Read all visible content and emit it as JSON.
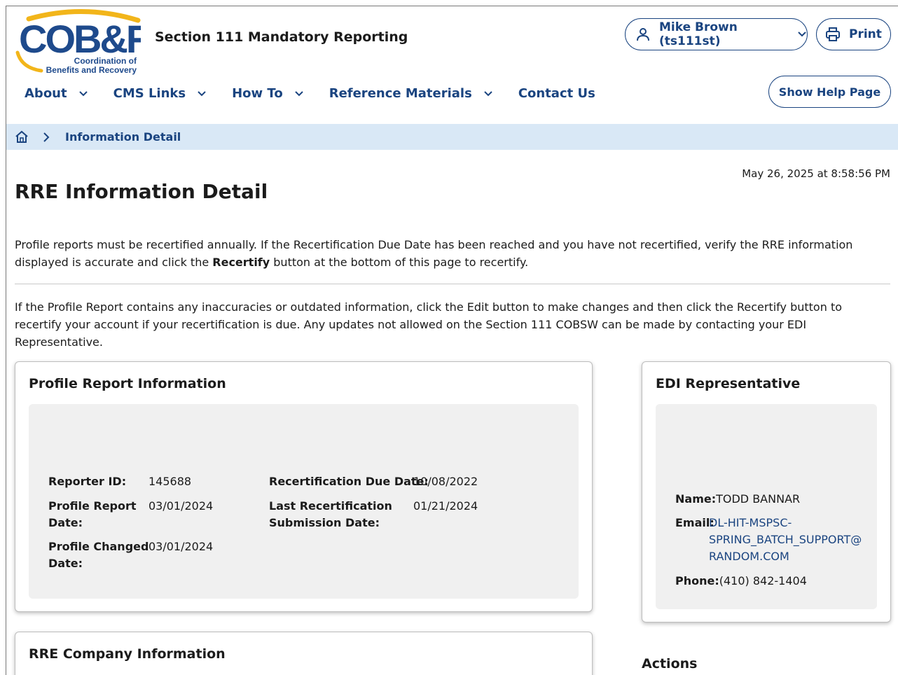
{
  "header": {
    "logo_text": "COB&R",
    "logo_sub_line1": "Coordination of",
    "logo_sub_line2": "Benefits and Recovery",
    "site_title": "Section 111 Mandatory Reporting",
    "user_label": "Mike Brown (ts111st)",
    "print_label": "Print",
    "help_label": "Show Help Page"
  },
  "nav": {
    "items": [
      {
        "label": "About",
        "dropdown": true
      },
      {
        "label": "CMS Links",
        "dropdown": true
      },
      {
        "label": "How To",
        "dropdown": true
      },
      {
        "label": "Reference Materials",
        "dropdown": true
      },
      {
        "label": "Contact Us",
        "dropdown": false
      }
    ]
  },
  "breadcrumb": {
    "current": "Information Detail"
  },
  "main": {
    "timestamp": "May 26, 2025 at 8:58:56 PM",
    "title": "RRE Information Detail",
    "para1_a": "Profile reports must be recertified annually. If the Recertification Due Date has been reached and you have not recertified, verify the RRE information displayed is accurate and click the ",
    "para1_bold": "Recertify",
    "para1_b": " button at the bottom of this page to recertify.",
    "para2": "If the Profile Report contains any inaccuracies or outdated information, click the Edit button to make changes and then click the Recertify button to recertify your account if your recertification is due. Any updates not allowed on the Section 111 COBSW can be made by contacting your EDI Representative."
  },
  "profile": {
    "title": "Profile Report Information",
    "reporter_id_label": "Reporter ID:",
    "reporter_id": "145688",
    "report_date_label_1": "Profile Report",
    "report_date_label_2": "Date:",
    "report_date": "03/01/2024",
    "changed_label_1": "Profile Changed",
    "changed_label_2": "Date:",
    "changed_date": "03/01/2024",
    "recert_due_label": "Recertification Due Date:",
    "recert_due": "10/08/2022",
    "last_recert_label_1": "Last Recertification",
    "last_recert_label_2": "Submission Date:",
    "last_recert": "01/21/2024"
  },
  "edi": {
    "title": "EDI Representative",
    "name_label": "Name:",
    "name": "TODD BANNAR",
    "email_label": "Email:",
    "email_line1": "DL-HIT-MSPSC-",
    "email_line2": "SPRING_BATCH_SUPPORT@",
    "email_line3": "RANDOM.COM",
    "phone_label": "Phone:",
    "phone": "(410) 842-1404"
  },
  "company": {
    "title": "RRE Company Information"
  },
  "actions": {
    "title": "Actions"
  },
  "colors": {
    "primary": "#1a4480",
    "logo_blue": "#1e4a8c",
    "logo_gold": "#f2b51a",
    "breadcrumb_bg": "#d9e8f6",
    "panel_bg": "#f0f0f0"
  },
  "icons": {
    "user": "user-icon",
    "print": "printer-icon",
    "chevron": "chevron-down-icon",
    "home": "home-icon",
    "separator": "chevron-right-icon"
  }
}
